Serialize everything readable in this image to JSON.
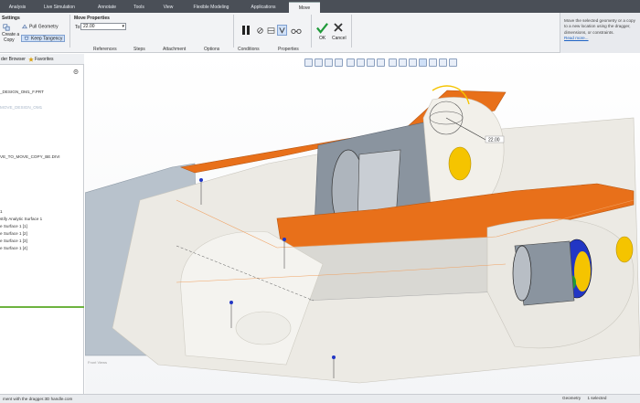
{
  "ribbon_tabs": [
    "Analysis",
    "Live Simulation",
    "Annotate",
    "Tools",
    "View",
    "Flexible Modeling",
    "Applications",
    "Move"
  ],
  "settings": {
    "title": "Settings",
    "create_copy": "Create a",
    "create_copy_2": "Copy",
    "pull_geometry": "Pull Geometry",
    "keep_tangency": "Keep Tangency"
  },
  "move_properties": {
    "title": "Move Properties",
    "to_label": "To:",
    "to_value": "22.00"
  },
  "actions": {
    "ok": "OK",
    "cancel": "Cancel"
  },
  "sub_tabs": [
    "References",
    "Steps",
    "Attachment",
    "Options",
    "Conditions",
    "Properties"
  ],
  "help": {
    "text": "Move the selected geometry or a copy to a new location using the dragger, dimensions, or constraints.",
    "link": "Read more..."
  },
  "left_panel": {
    "tab1": "der Browser",
    "tab2": "Favorites",
    "tree": [
      "_DESIGN_OM1_F.PRT",
      "MOVE_DESIGN_OM1",
      "VE_TO_MOVE_COPY_BE.DIVI",
      "1",
      "stify Analytic Surface 1",
      "e Surface 1 [1]",
      "e Surface 1 [2]",
      "e Surface 1 [3]",
      "e Surface 1 [4]"
    ]
  },
  "viewport": {
    "dimension": "22.00",
    "label": "Front Views"
  },
  "status": {
    "message": "ment with the dragger.3D handle.com",
    "right": "Geometry",
    "right_select": "1 selected"
  },
  "colors": {
    "orange": "#e8701a",
    "tabbar": "#4a4f57",
    "accent_green": "#1f9a39",
    "cancel_dark": "#333333"
  }
}
